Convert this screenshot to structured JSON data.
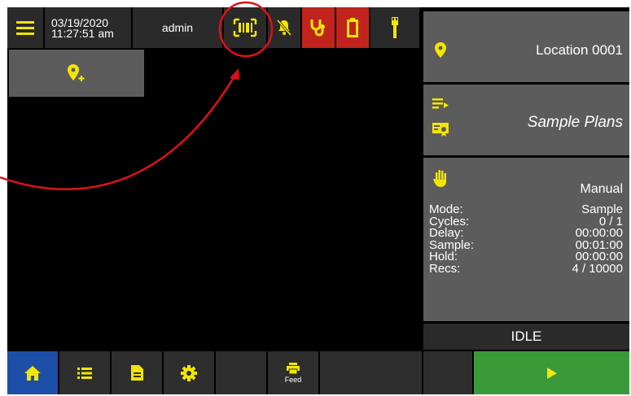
{
  "header": {
    "date": "03/19/2020",
    "time": "11:27:51 am",
    "user": "admin"
  },
  "location": {
    "label": "Location 0001"
  },
  "sample_plans": {
    "label": "Sample Plans"
  },
  "status_panel": {
    "mode_label": "Manual",
    "rows": [
      {
        "key": "Mode:",
        "value": "Sample"
      },
      {
        "key": "Cycles:",
        "value": "0 / 1"
      },
      {
        "key": "Delay:",
        "value": "00:00:00"
      },
      {
        "key": "Sample:",
        "value": "00:01:00"
      },
      {
        "key": "Hold:",
        "value": "00:00:00"
      },
      {
        "key": "Recs:",
        "value": "4 / 10000"
      }
    ]
  },
  "state": {
    "label": "IDLE"
  },
  "bottom_nav": {
    "feed_label": "Feed"
  },
  "colors": {
    "accent_yellow": "#f2e600",
    "alert_red": "#c0241c",
    "home_blue": "#1e4fa8",
    "start_green": "#3a9a3a",
    "annotation_red": "#e0101a"
  },
  "icons": [
    "menu-icon",
    "barcode-icon",
    "bell-off-icon",
    "stethoscope-icon",
    "battery-icon",
    "probe-icon",
    "add-location-icon",
    "location-pin-icon",
    "playlist-icon",
    "sample-plan-icon",
    "hand-icon",
    "home-icon",
    "list-icon",
    "document-icon",
    "gear-icon",
    "printer-icon",
    "play-icon"
  ]
}
